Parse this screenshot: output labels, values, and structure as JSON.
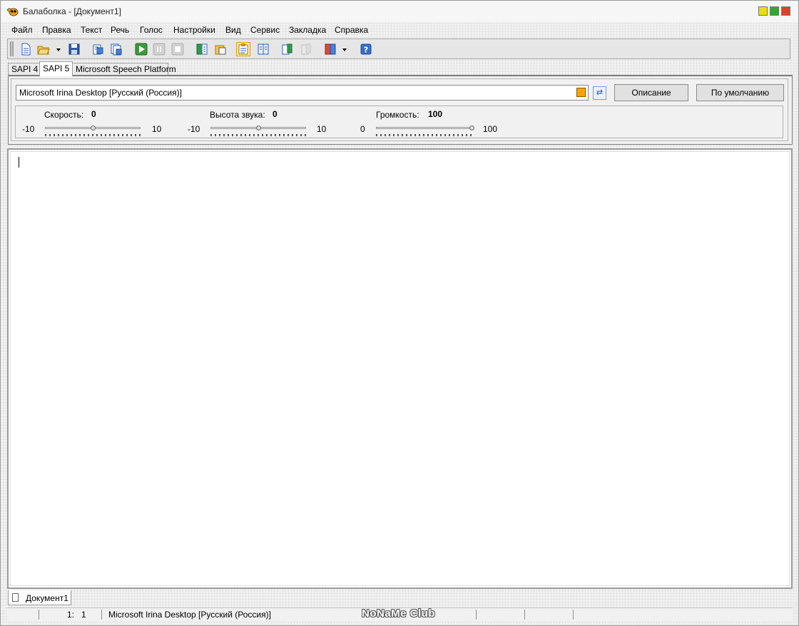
{
  "window": {
    "title": "Балаболка - [Документ1]"
  },
  "menu": {
    "items": [
      "Файл",
      "Правка",
      "Текст",
      "Речь",
      "Голос",
      "Настройки",
      "Вид",
      "Сервис",
      "Закладка",
      "Справка"
    ]
  },
  "toolbar": {
    "buttons": [
      "new-document-icon",
      "open-file-icon",
      "open-dropdown-icon",
      "save-icon",
      "convert-icon",
      "batch-convert-icon",
      "play-icon",
      "pause-icon",
      "stop-icon",
      "split-icon",
      "clipboard-icon",
      "read-clipboard-icon",
      "spell-check-icon",
      "bookmark-icon",
      "record-icon",
      "dictionary-icon",
      "dictionary-dropdown-icon",
      "help-icon"
    ],
    "active_button": "read-clipboard-icon"
  },
  "tabs": {
    "items": [
      "SAPI 4",
      "SAPI 5",
      "Microsoft Speech Platform"
    ],
    "selected": "SAPI 5"
  },
  "voice": {
    "selected": "Microsoft Irina Desktop [Русский (Россия)]",
    "color": "#f5a30a",
    "describe_label": "Описание",
    "default_label": "По умолчанию"
  },
  "sliders": {
    "rate": {
      "label": "Скорость:",
      "value": "0",
      "min": "-10",
      "max": "10",
      "fraction": 0.5
    },
    "pitch": {
      "label": "Высота звука:",
      "value": "0",
      "min": "-10",
      "max": "10",
      "fraction": 0.5
    },
    "volume": {
      "label": "Громкость:",
      "value": "100",
      "min": "0",
      "max": "100",
      "fraction": 1.0
    }
  },
  "editor": {
    "text": ""
  },
  "document_tabs": {
    "items": [
      "Документ1"
    ]
  },
  "status": {
    "position": "1:   1",
    "voice": "Microsoft Irina Desktop [Русский (Россия)]",
    "watermark": "NoNaMe Club"
  }
}
